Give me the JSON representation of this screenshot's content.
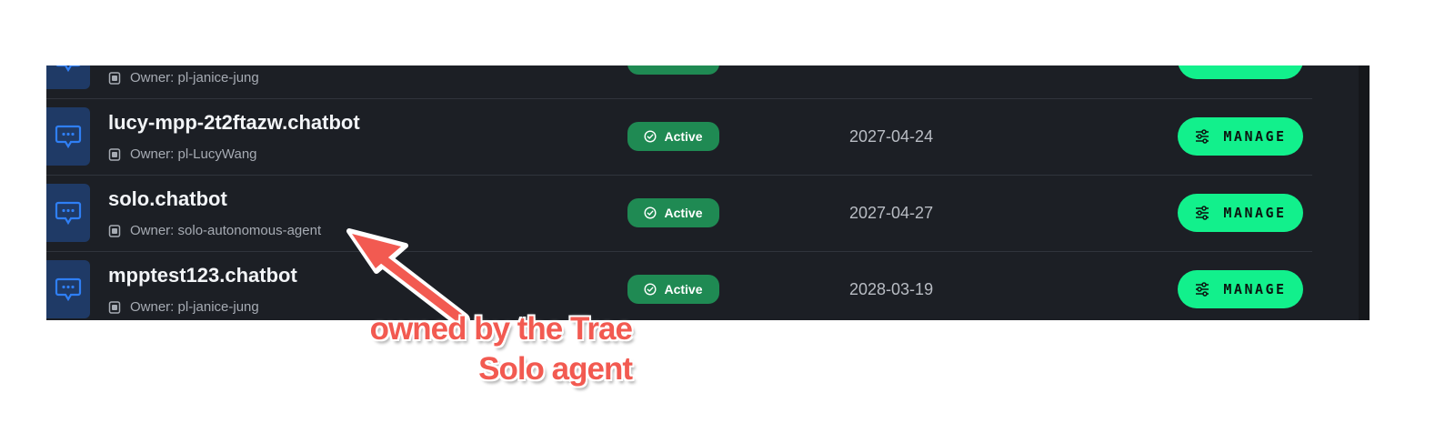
{
  "rows": [
    {
      "name": "",
      "owner": "Owner: pl-janice-jung",
      "status": "",
      "date": "",
      "action": ""
    },
    {
      "name": "lucy-mpp-2t2ftazw.chatbot",
      "owner": "Owner: pl-LucyWang",
      "status": "Active",
      "date": "2027-04-24",
      "action": "MANAGE"
    },
    {
      "name": "solo.chatbot",
      "owner": "Owner: solo-autonomous-agent",
      "status": "Active",
      "date": "2027-04-27",
      "action": "MANAGE"
    },
    {
      "name": "mpptest123.chatbot",
      "owner": "Owner: pl-janice-jung",
      "status": "Active",
      "date": "2028-03-19",
      "action": "MANAGE"
    }
  ],
  "annotation": {
    "line1": "owned by the Trae",
    "line2": "Solo agent"
  },
  "icons": {
    "bot": "chat-bubble-icon",
    "owner": "user-badge-icon",
    "status": "check-circle-icon",
    "manage": "sliders-icon"
  },
  "colors": {
    "panel_bg": "#1c1f25",
    "active_badge": "#1f8a53",
    "manage_button": "#12f08c",
    "annotation": "#f25a51"
  }
}
